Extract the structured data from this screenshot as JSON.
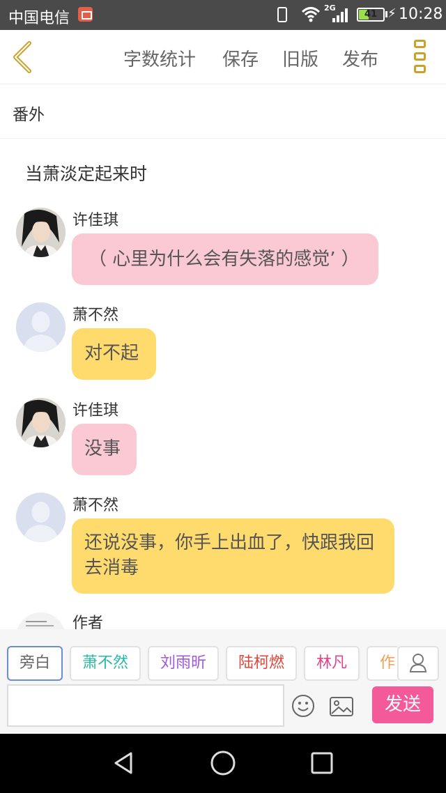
{
  "status_bar": {
    "carrier": "中国电信",
    "network": "2G",
    "battery": "41",
    "battery_level": 0.41,
    "time": "10:28"
  },
  "toolbar": {
    "word_count": "字数统计",
    "save": "保存",
    "old_version": "旧版",
    "publish": "发布"
  },
  "chapter": {
    "title": "番外",
    "heading": "当萧淡定起来时"
  },
  "messages": [
    {
      "speaker": "许佳琪",
      "text": "（ 心里为什么会有失落的感觉’ ）",
      "bubble_color": "#fbc9d4",
      "avatar": "photo-avatar"
    },
    {
      "speaker": "萧不然",
      "text": "对不起",
      "bubble_color": "#ffdb6e",
      "avatar": "default-avatar"
    },
    {
      "speaker": "许佳琪",
      "text": "没事",
      "bubble_color": "#fbc9d4",
      "avatar": "photo-avatar"
    },
    {
      "speaker": "萧不然",
      "text": "还说没事，你手上出血了，快跟我回去消毒",
      "bubble_color": "#ffdb6e",
      "avatar": "default-avatar"
    },
    {
      "speaker": "作者",
      "avatar": "author-avatar"
    }
  ],
  "characters": [
    {
      "label": "旁白",
      "color": "#666666",
      "active": true
    },
    {
      "label": "萧不然",
      "color": "#2bb8a3",
      "active": false
    },
    {
      "label": "刘雨昕",
      "color": "#a05ad8",
      "active": false
    },
    {
      "label": "陆柯燃",
      "color": "#e0453a",
      "active": false
    },
    {
      "label": "林凡",
      "color": "#e0458c",
      "active": false
    },
    {
      "label": "作",
      "color": "#f0a050",
      "active": false
    }
  ],
  "composer": {
    "input_value": "",
    "send_label": "发送"
  },
  "colors": {
    "accent_yellow": "#c9a227",
    "send_pink": "#f45a9a",
    "bubble_pink": "#fbc9d4",
    "bubble_yellow": "#ffdb6e"
  }
}
